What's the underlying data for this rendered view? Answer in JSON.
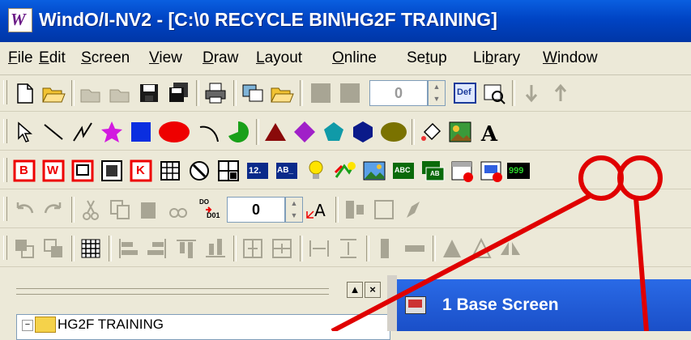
{
  "window": {
    "title": "WindO/I-NV2 - [C:\\0 RECYCLE BIN\\HG2F TRAINING]",
    "app_icon_glyph": "W"
  },
  "menu": [
    {
      "label": "File",
      "key": "F",
      "rest": "ile"
    },
    {
      "label": "Edit",
      "key": "E",
      "rest": "dit"
    },
    {
      "label": "Screen",
      "key": "S",
      "rest": "creen"
    },
    {
      "label": "View",
      "key": "V",
      "rest": "iew"
    },
    {
      "label": "Draw",
      "key": "D",
      "rest": "raw"
    },
    {
      "label": "Layout",
      "key": "L",
      "rest": "ayout"
    },
    {
      "label": "Online",
      "key": "O",
      "rest": "nline"
    },
    {
      "label": "Setup",
      "pre": "Se",
      "key": "t",
      "rest": "up"
    },
    {
      "label": "Library",
      "pre": "Li",
      "key": "b",
      "rest": "rary"
    },
    {
      "label": "Window",
      "key": "W",
      "rest": "indow"
    }
  ],
  "toolbar1": {
    "spin_value": "0",
    "def_label": "Def"
  },
  "toolbar3": {
    "labels": {
      "bit_button": "B",
      "word_button": "W",
      "k_button": "K",
      "num12": "12.",
      "ab": "AB_",
      "abc": "ABC",
      "ab2": "AB",
      "num999": "999"
    }
  },
  "toolbar4": {
    "spin_value": "0",
    "do_label": "DO",
    "d01_label": "D01"
  },
  "panel": {
    "min_button": "▲",
    "close_button": "×",
    "tree_root": "HG2F TRAINING",
    "expander": "−"
  },
  "screen_window": {
    "title": "1  Base Screen"
  },
  "colors": {
    "title_bar": "#0044c4",
    "highlight_ring": "#e00000",
    "pointer_line": "#e00000"
  }
}
